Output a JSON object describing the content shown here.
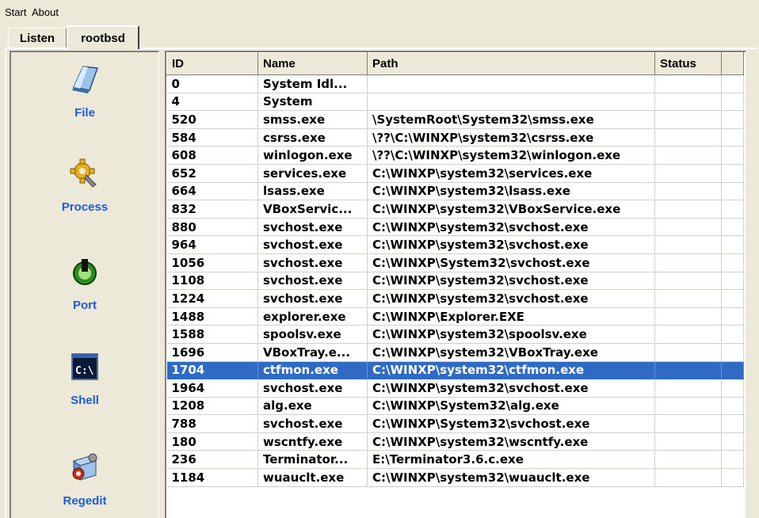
{
  "menubar": {
    "start": "Start",
    "about": "About"
  },
  "tabs": {
    "listen": "Listen",
    "active": "rootbsd"
  },
  "sidebar": {
    "file": "File",
    "process": "Process",
    "port": "Port",
    "shell": "Shell",
    "regedit": "Regedit"
  },
  "table": {
    "columns": {
      "id": "ID",
      "name": "Name",
      "path": "Path",
      "status": "Status"
    },
    "rows": [
      {
        "id": "0",
        "name": "System Idl...",
        "path": ""
      },
      {
        "id": "4",
        "name": "System",
        "path": ""
      },
      {
        "id": "520",
        "name": "smss.exe",
        "path": "\\SystemRoot\\System32\\smss.exe"
      },
      {
        "id": "584",
        "name": "csrss.exe",
        "path": "\\??\\C:\\WINXP\\system32\\csrss.exe"
      },
      {
        "id": "608",
        "name": "winlogon.exe",
        "path": "\\??\\C:\\WINXP\\system32\\winlogon.exe"
      },
      {
        "id": "652",
        "name": "services.exe",
        "path": "C:\\WINXP\\system32\\services.exe"
      },
      {
        "id": "664",
        "name": "lsass.exe",
        "path": "C:\\WINXP\\system32\\lsass.exe"
      },
      {
        "id": "832",
        "name": "VBoxServic...",
        "path": "C:\\WINXP\\system32\\VBoxService.exe"
      },
      {
        "id": "880",
        "name": "svchost.exe",
        "path": "C:\\WINXP\\system32\\svchost.exe"
      },
      {
        "id": "964",
        "name": "svchost.exe",
        "path": "C:\\WINXP\\system32\\svchost.exe"
      },
      {
        "id": "1056",
        "name": "svchost.exe",
        "path": "C:\\WINXP\\System32\\svchost.exe"
      },
      {
        "id": "1108",
        "name": "svchost.exe",
        "path": "C:\\WINXP\\system32\\svchost.exe"
      },
      {
        "id": "1224",
        "name": "svchost.exe",
        "path": "C:\\WINXP\\system32\\svchost.exe"
      },
      {
        "id": "1488",
        "name": "explorer.exe",
        "path": "C:\\WINXP\\Explorer.EXE"
      },
      {
        "id": "1588",
        "name": "spoolsv.exe",
        "path": "C:\\WINXP\\system32\\spoolsv.exe"
      },
      {
        "id": "1696",
        "name": "VBoxTray.e...",
        "path": "C:\\WINXP\\system32\\VBoxTray.exe"
      },
      {
        "id": "1704",
        "name": "ctfmon.exe",
        "path": "C:\\WINXP\\system32\\ctfmon.exe"
      },
      {
        "id": "1964",
        "name": "svchost.exe",
        "path": "C:\\WINXP\\system32\\svchost.exe"
      },
      {
        "id": "1208",
        "name": "alg.exe",
        "path": "C:\\WINXP\\System32\\alg.exe"
      },
      {
        "id": "788",
        "name": "svchost.exe",
        "path": "C:\\WINXP\\System32\\svchost.exe"
      },
      {
        "id": "180",
        "name": "wscntfy.exe",
        "path": "C:\\WINXP\\system32\\wscntfy.exe"
      },
      {
        "id": "236",
        "name": "Terminator...",
        "path": "E:\\Terminator3.6.c.exe"
      },
      {
        "id": "1184",
        "name": "wuauclt.exe",
        "path": "C:\\WINXP\\system32\\wuauclt.exe"
      }
    ]
  },
  "colors": {
    "selection": "#316ac5",
    "sidebar_label": "#1e5bd6",
    "window_bg": "#ece9d8"
  }
}
